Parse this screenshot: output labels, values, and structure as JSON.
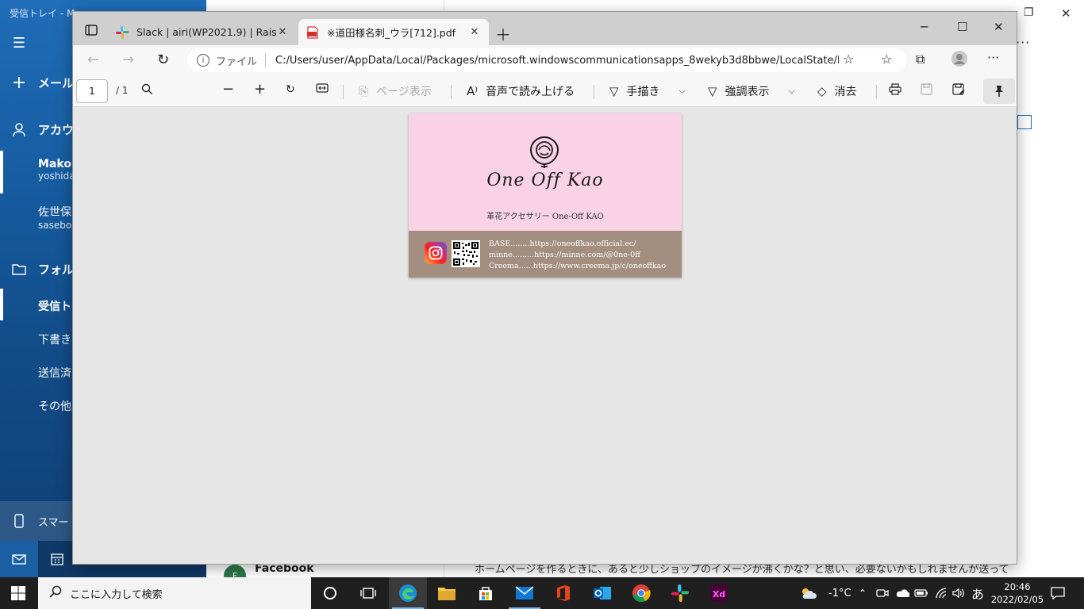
{
  "mail": {
    "window_title": "受信トレイ - M",
    "new_mail": "メール",
    "accounts_label": "アカウ",
    "accounts": [
      {
        "name": "Mako",
        "email": "yoshida"
      },
      {
        "name": "佐世保",
        "email": "sasebo"
      }
    ],
    "folders_label": "フォル",
    "folders": [
      "受信ト",
      "下書き",
      "送信済",
      "その他"
    ],
    "phone_link": "スマートフ",
    "preview_sender": "Facebook",
    "preview_avatar": "F",
    "preview_text": "ホームページを作るときに、あると少しショップのイメージが沸くかな？と思い、必要ないかもしれませんが送って"
  },
  "browser": {
    "tabs": [
      {
        "label": "Slack | airi(WP2021.9) | RaiseTech",
        "active": false
      },
      {
        "label": "※道田様名刺_ウラ[712].pdf",
        "active": true
      }
    ],
    "address": {
      "protocol_label": "ファイル",
      "url": "C:/Users/user/AppData/Local/Packages/microsoft.windowscommunicationsapps_8wekyb3d8bbwe/LocalState/File..."
    },
    "pdf_toolbar": {
      "page_current": "1",
      "page_total": "/ 1",
      "page_view": "ページ表示",
      "read_aloud": "音声で読み上げる",
      "draw": "手描き",
      "highlight": "強調表示",
      "erase": "消去"
    }
  },
  "card": {
    "brand": "One Off Kao",
    "tagline": "革花アクセサリー One-Off KAO",
    "links": [
      "BASE........https://oneoffkao.official.ec/",
      "minne.........https://minne.com/@0ne-0ff",
      "Creema......https://www.creema.jp/c/oneoffkao"
    ],
    "colors": {
      "background": "#f9d3e5",
      "band": "#a38e80"
    }
  },
  "taskbar": {
    "search_placeholder": "ここに入力して検索",
    "weather": "-1°C",
    "ime": "あ",
    "time": "20:46",
    "date": "2022/02/05"
  }
}
